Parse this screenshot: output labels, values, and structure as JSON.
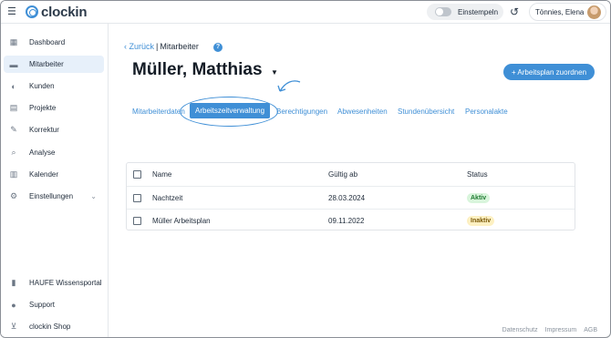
{
  "app": {
    "logo_text": "clockin"
  },
  "topbar": {
    "clockin_label": "Einstempeln",
    "user_name": "Tönnies, Elena"
  },
  "sidebar": {
    "items": [
      {
        "label": "Dashboard",
        "icon": "dashboard-icon"
      },
      {
        "label": "Mitarbeiter",
        "icon": "users-icon"
      },
      {
        "label": "Kunden",
        "icon": "handshake-icon"
      },
      {
        "label": "Projekte",
        "icon": "clipboard-icon"
      },
      {
        "label": "Korrektur",
        "icon": "edit-icon"
      },
      {
        "label": "Analyse",
        "icon": "search-chart-icon"
      },
      {
        "label": "Kalender",
        "icon": "calendar-icon"
      },
      {
        "label": "Einstellungen",
        "icon": "gear-icon"
      }
    ],
    "bottom_items": [
      {
        "label": "HAUFE Wissensportal",
        "icon": "book-icon"
      },
      {
        "label": "Support",
        "icon": "info-icon"
      },
      {
        "label": "clockin Shop",
        "icon": "cart-icon"
      }
    ]
  },
  "breadcrumb": {
    "back": "Zurück",
    "separator": "|",
    "current": "Mitarbeiter"
  },
  "page": {
    "title": "Müller, Matthias",
    "assign_button": "+ Arbeitsplan zuordnen"
  },
  "tabs": [
    {
      "label": "Mitarbeiterdaten"
    },
    {
      "label": "Arbeitszeitverwaltung"
    },
    {
      "label": "Berechtigungen"
    },
    {
      "label": "Abwesenheiten"
    },
    {
      "label": "Stundenübersicht"
    },
    {
      "label": "Personalakte"
    }
  ],
  "table": {
    "columns": [
      "Name",
      "Gültig ab",
      "Status"
    ],
    "rows": [
      {
        "name": "Nachtzeit",
        "valid_from": "28.03.2024",
        "status": "Aktiv"
      },
      {
        "name": "Müller Arbeitsplan",
        "valid_from": "09.11.2022",
        "status": "Inaktiv"
      }
    ]
  },
  "footer": {
    "links": [
      "Datenschutz",
      "Impressum",
      "AGB"
    ]
  },
  "colors": {
    "accent": "#3f8fd6",
    "active_badge": "#d9f5dc",
    "inactive_badge": "#fdf0c2"
  }
}
